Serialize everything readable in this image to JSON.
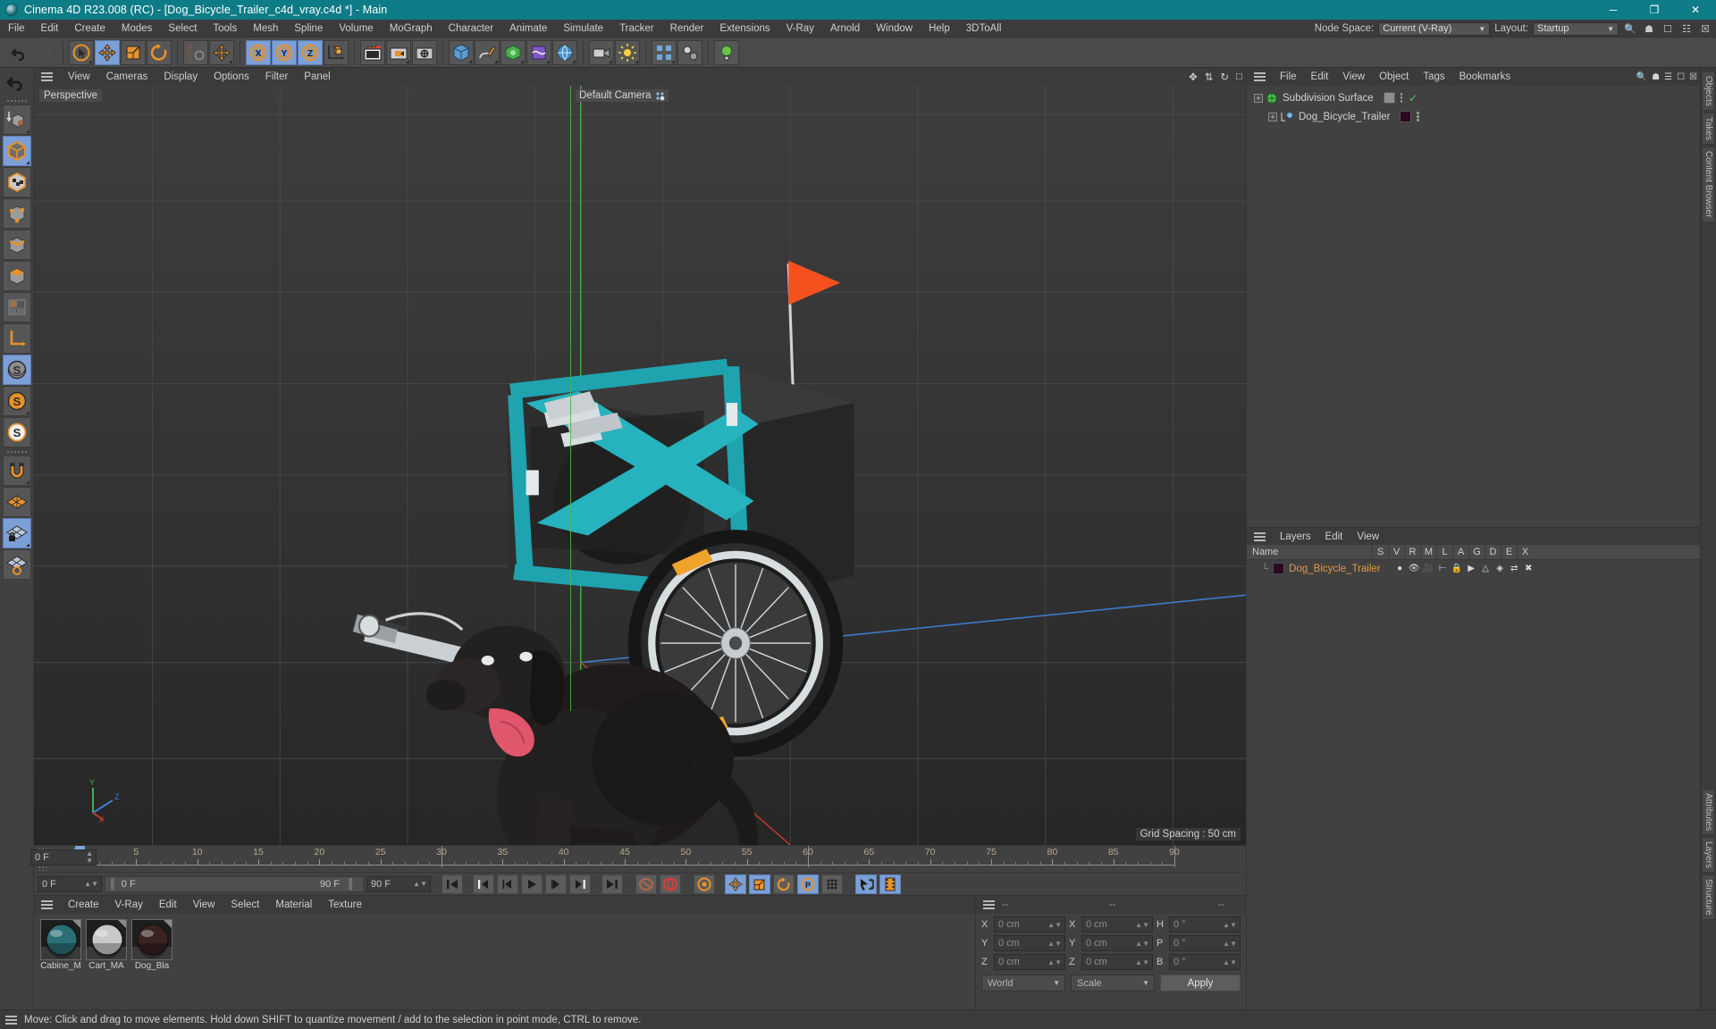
{
  "window": {
    "title": "Cinema 4D R23.008 (RC) - [Dog_Bicycle_Trailer_c4d_vray.c4d *] - Main",
    "minimize": "─",
    "maximize": "❐",
    "close": "✕"
  },
  "menubar": {
    "items": [
      "File",
      "Edit",
      "Create",
      "Modes",
      "Select",
      "Tools",
      "Mesh",
      "Spline",
      "Volume",
      "MoGraph",
      "Character",
      "Animate",
      "Simulate",
      "Tracker",
      "Render",
      "Extensions",
      "V-Ray",
      "Arnold",
      "Window",
      "Help",
      "3DToAll"
    ],
    "node_space_label": "Node Space:",
    "node_space_value": "Current (V-Ray)",
    "layout_label": "Layout:",
    "layout_value": "Startup"
  },
  "toolbar": {
    "undo": "undo-icon",
    "redo": "redo-icon",
    "select": "live-selection-icon",
    "move": "move-tool-icon",
    "scale": "scale-tool-icon",
    "rotate": "rotate-tool-icon",
    "psr": "psr-icon",
    "move_dup": "move-tool-secondary-icon",
    "x": "X",
    "y": "Y",
    "z": "Z",
    "world": "world-coordinate-icon",
    "render_view": "render-view-icon",
    "render_region": "render-region-icon",
    "render_settings": "render-settings-icon",
    "cube": "cube-primitive-icon",
    "spline": "spline-pen-icon",
    "generator": "generator-icon",
    "deformer": "deformer-icon",
    "environment": "environment-icon",
    "camera": "camera-icon",
    "light": "light-icon",
    "mograph": "mograph-icon",
    "motion": "motion-tracker-icon",
    "bulb": "bulb-icon"
  },
  "lefttools": {
    "undo_arrow": "undo-arrow-icon",
    "items": [
      "make-editable-icon",
      "model-mode-icon",
      "texture-mode-icon",
      "points-mode-icon",
      "edges-mode-icon",
      "polygons-mode-icon",
      "uv-mode-icon",
      "axis-mode-icon",
      "enable-axis-icon",
      "enable-snap-icon",
      "workplane-snap-icon",
      "magnet-icon",
      "grid-icon",
      "locked-workplane-icon",
      "rotate-workplane-icon"
    ]
  },
  "viewport": {
    "menu": [
      "View",
      "Cameras",
      "Display",
      "Options",
      "Filter",
      "Panel"
    ],
    "label": "Perspective",
    "camera_label": "Default Camera",
    "grid_spacing": "Grid Spacing : 50 cm"
  },
  "timeline": {
    "ticks": [
      0,
      5,
      10,
      15,
      20,
      25,
      30,
      35,
      40,
      45,
      50,
      55,
      60,
      65,
      70,
      75,
      80,
      85,
      90
    ],
    "current_frame": "0 F",
    "current_frame_right": "0 F",
    "preview_start": "0 F",
    "preview_end": "90 F",
    "frame_end_field": "90 F",
    "frame_end_field2": "90 F",
    "transport": {
      "go_to_start": "go-to-start-icon",
      "prev_key": "previous-keyframe-icon",
      "prev_frame": "previous-frame-icon",
      "play": "play-icon",
      "next_frame": "next-frame-icon",
      "next_key": "next-keyframe-icon",
      "go_to_end": "go-to-end-icon",
      "record": "record-icon",
      "autokey": "autokeying-icon",
      "keyframe_selection": "keyframe-selection-icon",
      "position": "position-key-icon",
      "scale": "scale-key-icon",
      "rotation": "rotation-key-icon",
      "param": "parameter-key-icon",
      "pla": "point-level-animation-icon",
      "anim_mode": "animation-mode-icon",
      "timeline_mode": "timeline-mode-icon"
    }
  },
  "material_manager": {
    "menu": [
      "Create",
      "V-Ray",
      "Edit",
      "View",
      "Select",
      "Material",
      "Texture"
    ],
    "materials": [
      {
        "name": "Cabine_M",
        "swatch": "#2b6f75"
      },
      {
        "name": "Cart_MA",
        "swatch": "#c9c9c9"
      },
      {
        "name": "Dog_Bla",
        "swatch": "#3a2220"
      }
    ]
  },
  "coordinates": {
    "headers": [
      "--",
      "--",
      "--"
    ],
    "rows": [
      {
        "axis1": "X",
        "val1": "0 cm",
        "axis2": "X",
        "val2": "0 cm",
        "axis3": "H",
        "val3": "0 °"
      },
      {
        "axis1": "Y",
        "val1": "0 cm",
        "axis2": "Y",
        "val2": "0 cm",
        "axis3": "P",
        "val3": "0 °"
      },
      {
        "axis1": "Z",
        "val1": "0 cm",
        "axis2": "Z",
        "val2": "0 cm",
        "axis3": "B",
        "val3": "0 °"
      }
    ],
    "space": "World",
    "mode": "Scale",
    "apply": "Apply"
  },
  "object_manager": {
    "menu": [
      "File",
      "Edit",
      "View",
      "Object",
      "Tags",
      "Bookmarks"
    ],
    "items": [
      {
        "name": "Subdivision Surface",
        "depth": 0,
        "tag_color": "#8d8d8d",
        "check": "✓"
      },
      {
        "name": "Dog_Bicycle_Trailer",
        "depth": 1,
        "tag_color": "#2b0a21",
        "check": ""
      }
    ]
  },
  "layer_manager": {
    "menu": [
      "Layers",
      "Edit",
      "View"
    ],
    "columns": [
      "Name",
      "S",
      "V",
      "R",
      "M",
      "L",
      "A",
      "G",
      "D",
      "E",
      "X"
    ],
    "rows": [
      {
        "name": "Dog_Bicycle_Trailer",
        "color": "#2b0a21"
      }
    ]
  },
  "right_tabs": [
    "Objects",
    "Takes",
    "Content Browser"
  ],
  "right_tabs_lower": [
    "Attributes",
    "Layers",
    "Structure"
  ],
  "statusbar": {
    "message": "Move: Click and drag to move elements. Hold down SHIFT to quantize movement / add to the selection in point mode, CTRL to remove."
  },
  "colors": {
    "title_bg": "#0e7c86",
    "panel_bg": "#414141",
    "accent_orange": "#e8922a",
    "accent_blue": "#7b9fd6",
    "layer_text": "#e09a48"
  }
}
